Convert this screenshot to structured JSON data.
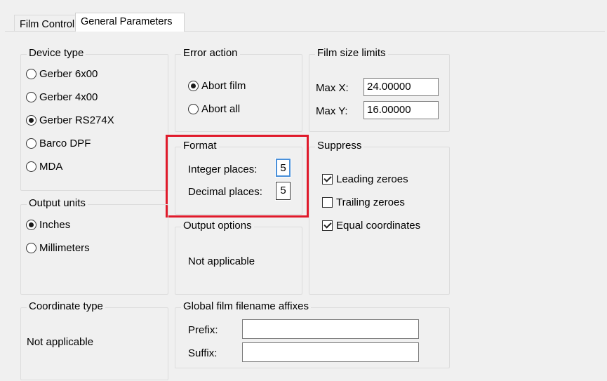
{
  "tabs": [
    {
      "label": "Film Control",
      "active": false
    },
    {
      "label": "General Parameters",
      "active": true
    }
  ],
  "device_type": {
    "title": "Device type",
    "options": [
      {
        "label": "Gerber 6x00",
        "selected": false
      },
      {
        "label": "Gerber 4x00",
        "selected": false
      },
      {
        "label": "Gerber RS274X",
        "selected": true
      },
      {
        "label": "Barco DPF",
        "selected": false
      },
      {
        "label": "MDA",
        "selected": false
      }
    ]
  },
  "error_action": {
    "title": "Error action",
    "options": [
      {
        "label": "Abort film",
        "selected": true
      },
      {
        "label": "Abort all",
        "selected": false
      }
    ]
  },
  "film_size_limits": {
    "title": "Film size limits",
    "max_x_label": "Max X:",
    "max_x_value": "24.00000",
    "max_y_label": "Max Y:",
    "max_y_value": "16.00000"
  },
  "format": {
    "title": "Format",
    "integer_label": "Integer places:",
    "integer_value": "5",
    "decimal_label": "Decimal places:",
    "decimal_value": "5",
    "highlight_color": "#e01a2b"
  },
  "suppress": {
    "title": "Suppress",
    "options": [
      {
        "label": "Leading zeroes",
        "checked": true
      },
      {
        "label": "Trailing zeroes",
        "checked": false
      },
      {
        "label": "Equal coordinates",
        "checked": true
      }
    ]
  },
  "output_units": {
    "title": "Output units",
    "options": [
      {
        "label": "Inches",
        "selected": true
      },
      {
        "label": "Millimeters",
        "selected": false
      }
    ]
  },
  "output_options": {
    "title": "Output options",
    "text": "Not applicable"
  },
  "coordinate_type": {
    "title": "Coordinate type",
    "text": "Not applicable"
  },
  "filename_affixes": {
    "title": "Global film filename affixes",
    "prefix_label": "Prefix:",
    "prefix_value": "",
    "suffix_label": "Suffix:",
    "suffix_value": ""
  }
}
